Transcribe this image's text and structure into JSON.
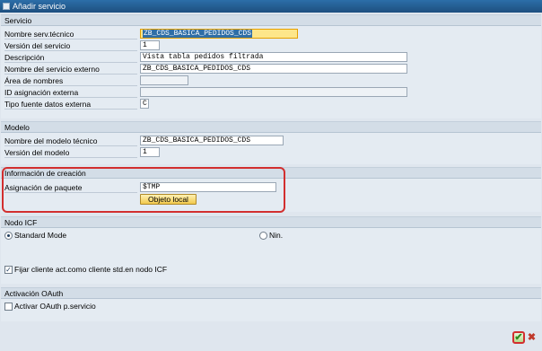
{
  "window": {
    "title": "Añadir servicio"
  },
  "servicio": {
    "header": "Servicio",
    "nombre_label": "Nombre serv.técnico",
    "nombre_value": "ZB_CDS_BASICA_PEDIDOS_CDS",
    "version_label": "Versión del servicio",
    "version_value": "1",
    "descripcion_label": "Descripción",
    "descripcion_value": "Vista tabla pedidos filtrada",
    "externo_label": "Nombre del servicio externo",
    "externo_value": "ZB_CDS_BASICA_PEDIDOS_CDS",
    "area_label": "Área de nombres",
    "area_value": "",
    "id_label": "ID asignación externa",
    "id_value": "",
    "tipo_label": "Tipo fuente datos externa",
    "tipo_value": "C"
  },
  "modelo": {
    "header": "Modelo",
    "nombre_label": "Nombre del modelo técnico",
    "nombre_value": "ZB_CDS_BASICA_PEDIDOS_CDS",
    "version_label": "Versión del modelo",
    "version_value": "1"
  },
  "creacion": {
    "header": "Información de creación",
    "paquete_label": "Asignación de paquete",
    "paquete_value": "$TMP",
    "objeto_local_button": "Objeto local"
  },
  "icf": {
    "header": "Nodo ICF",
    "standard_label": "Standard Mode",
    "standard_selected": true,
    "nin_label": "Nin.",
    "nin_selected": false,
    "fijar_label": "Fijar cliente act.como cliente std.en nodo ICF",
    "fijar_checked": true
  },
  "oauth": {
    "header": "Activación OAuth",
    "activar_label": "Activar OAuth p.servicio",
    "activar_checked": false
  },
  "footer": {
    "ok_icon": "checkmark-icon",
    "cancel_icon": "cross-icon"
  },
  "colors": {
    "highlight_border": "#d22f2f",
    "focus_field": "#fde68a",
    "button": "#f2c94c"
  }
}
